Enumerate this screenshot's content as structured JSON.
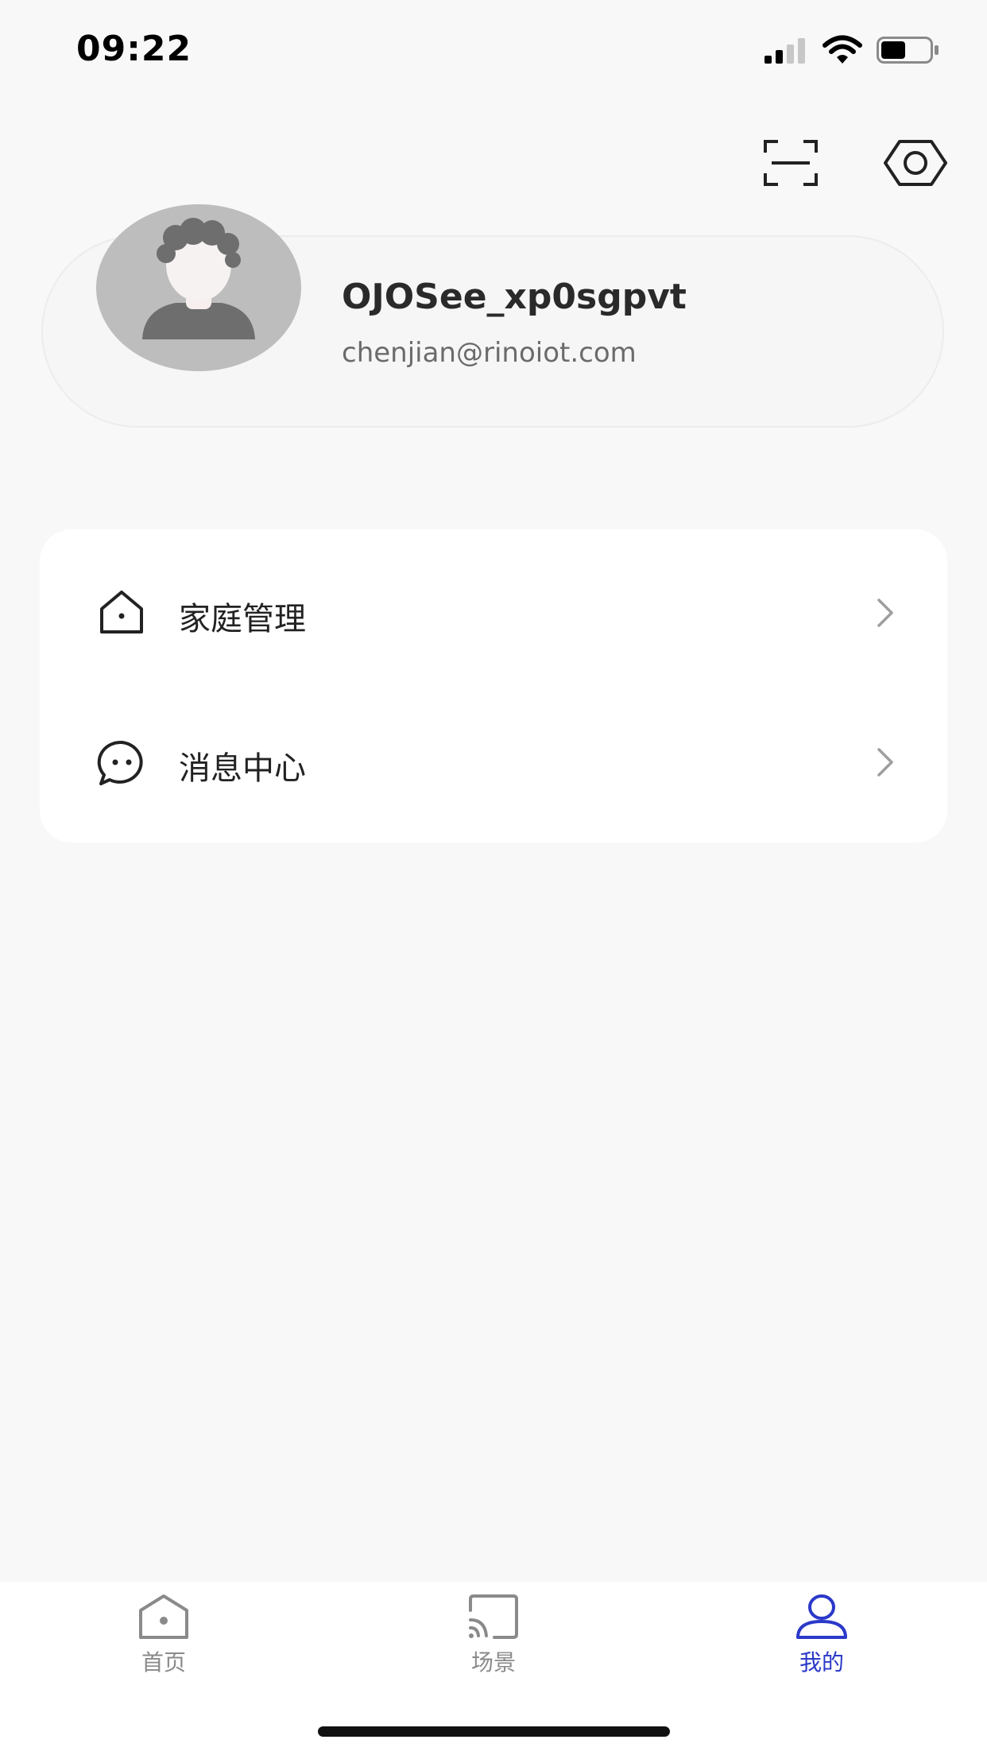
{
  "status_bar": {
    "time": "09:22",
    "signal_icon": "cellular-signal-icon",
    "wifi_icon": "wifi-icon",
    "battery_icon": "battery-icon"
  },
  "header": {
    "scan_icon": "scan-icon",
    "settings_icon": "gear-icon"
  },
  "profile": {
    "avatar_icon": "default-avatar",
    "name": "OJOSee_xp0sgpvt",
    "email": "chenjian@rinoiot.com"
  },
  "menu": {
    "items": [
      {
        "label": "家庭管理",
        "icon": "home-icon"
      },
      {
        "label": "消息中心",
        "icon": "chat-icon"
      }
    ]
  },
  "tab_bar": {
    "tabs": [
      {
        "label": "首页",
        "icon": "home-tab-icon",
        "active": false
      },
      {
        "label": "场景",
        "icon": "cast-screen-icon",
        "active": false
      },
      {
        "label": "我的",
        "icon": "user-icon",
        "active": true
      }
    ],
    "active_color": "#2a39c9",
    "inactive_color": "#8a8a8a"
  }
}
